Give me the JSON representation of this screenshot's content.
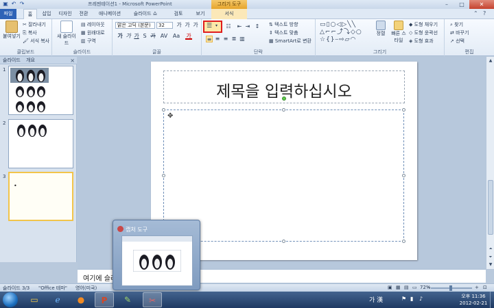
{
  "window": {
    "title": "프레젠테이션1 - Microsoft PowerPoint",
    "context_tab": "그리기 도구",
    "minimize": "–",
    "maximize": "□",
    "close": "✕"
  },
  "quick_access": [
    "save-icon",
    "undo-icon",
    "redo-icon"
  ],
  "tabs": [
    "파일",
    "홈",
    "삽입",
    "디자인",
    "전환",
    "애니메이션",
    "슬라이드 쇼",
    "검토",
    "보기",
    "서식"
  ],
  "ribbon": {
    "clipboard": {
      "label": "클립보드",
      "paste": "붙여넣기",
      "cut": "잘라내기",
      "copy": "복사",
      "format_painter": "서식 복사"
    },
    "slides": {
      "label": "슬라이드",
      "new_slide": "새 슬라이드",
      "layout": "레이아웃",
      "reset": "원래대로",
      "section": "구역"
    },
    "font": {
      "label": "글꼴",
      "font_name": "맑은 고딕 (본문)",
      "font_size": "32",
      "bold": "가",
      "italic": "가",
      "underline": "가",
      "strike": "가",
      "shadow": "S",
      "spacing": "AV",
      "case": "Aa",
      "grow": "가",
      "shrink": "가",
      "clear": "가",
      "font_color": "가"
    },
    "paragraph": {
      "label": "단락",
      "text_direction": "텍스트 방향",
      "align_text": "텍스트 맞춤",
      "smartart": "SmartArt로 변환"
    },
    "drawing": {
      "label": "그리기",
      "arrange": "정렬",
      "quick_styles": "빠른 스타일",
      "shape_fill": "도형 채우기",
      "shape_outline": "도형 윤곽선",
      "shape_effects": "도형 효과"
    },
    "editing": {
      "label": "편집",
      "find": "찾기",
      "replace": "바꾸기",
      "select": "선택"
    }
  },
  "left_pane": {
    "tabs": [
      "슬라이드",
      "개요"
    ],
    "close": "×",
    "slides": [
      {
        "number": "1"
      },
      {
        "number": "2"
      },
      {
        "number": "3",
        "bullet": "•"
      }
    ]
  },
  "slide": {
    "title_placeholder": "제목을 입력하십시오"
  },
  "notes": {
    "text": "여기에 슬라이드 노트를 입력하십시오"
  },
  "status": {
    "slide_index": "슬라이드 3/3",
    "theme": "\"Office 테마\"",
    "language": "영어(미국)",
    "zoom": "72%"
  },
  "preview": {
    "title": "캡처 도구"
  },
  "taskbar": {
    "tray_ime": "가 漢",
    "time": "오후 11:36",
    "date": "2012-02-21"
  },
  "colors": {
    "file_tab": "#2e63b7",
    "highlight_border": "#e01c1c",
    "selected_slide_border": "#f2c44a"
  }
}
